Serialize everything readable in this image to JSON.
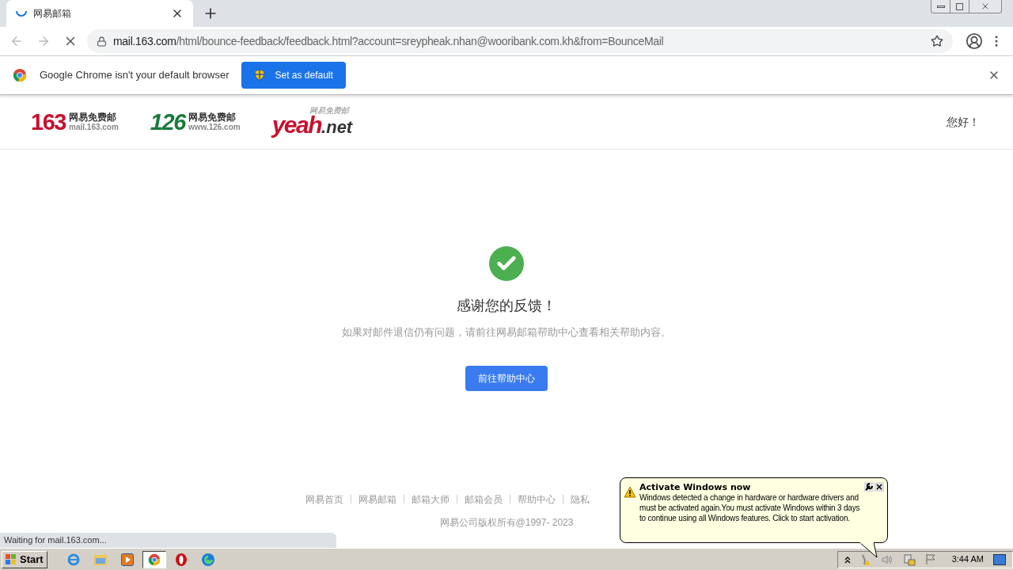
{
  "browser": {
    "tabs": [
      {
        "title": "网易邮箱",
        "loading": true,
        "selected": true
      }
    ],
    "address": {
      "host": "mail.163.com",
      "path": "/html/bounce-feedback/feedback.html?account=sreypheak.nhan@wooribank.com.kh&from=BounceMail"
    },
    "infobar": {
      "message": "Google Chrome isn't your default browser",
      "button": "Set as default"
    },
    "status": "Waiting for mail.163.com..."
  },
  "header": {
    "logos": [
      {
        "kind": "redmark",
        "number": "163",
        "name": "网易免费邮",
        "domain": "mail.163.com"
      },
      {
        "kind": "greenmark",
        "number": "126",
        "name": "网易免费邮",
        "domain": "www.126.com"
      },
      {
        "kind": "yeah",
        "word": "yeah",
        "suffix": ".net",
        "name": "网易免费邮"
      }
    ],
    "greeting": "您好！"
  },
  "content": {
    "title": "感谢您的反馈！",
    "message": "如果对邮件退信仍有问题，请前往网易邮箱帮助中心查看相关帮助内容。",
    "button": "前往帮助中心"
  },
  "footer": {
    "links": [
      "网易首页",
      "网易邮箱",
      "邮箱大师",
      "邮箱会员",
      "帮助中心",
      "隐私"
    ],
    "copyright": "网易公司版权所有@1997- 2023"
  },
  "balloon": {
    "title": "Activate Windows now",
    "message": "Windows detected a change in hardware or hardware drivers and must be activated again.You must activate Windows within 3 days to continue using all Windows features. Click to start activation."
  },
  "taskbar": {
    "start": "Start",
    "apps": [
      {
        "kind": "ie",
        "selected": false
      },
      {
        "kind": "explorer",
        "selected": false
      },
      {
        "kind": "media",
        "selected": false
      },
      {
        "kind": "chrome",
        "selected": true
      },
      {
        "kind": "opera",
        "selected": false
      },
      {
        "kind": "edge",
        "selected": false
      }
    ],
    "clock": "3:44 AM"
  }
}
